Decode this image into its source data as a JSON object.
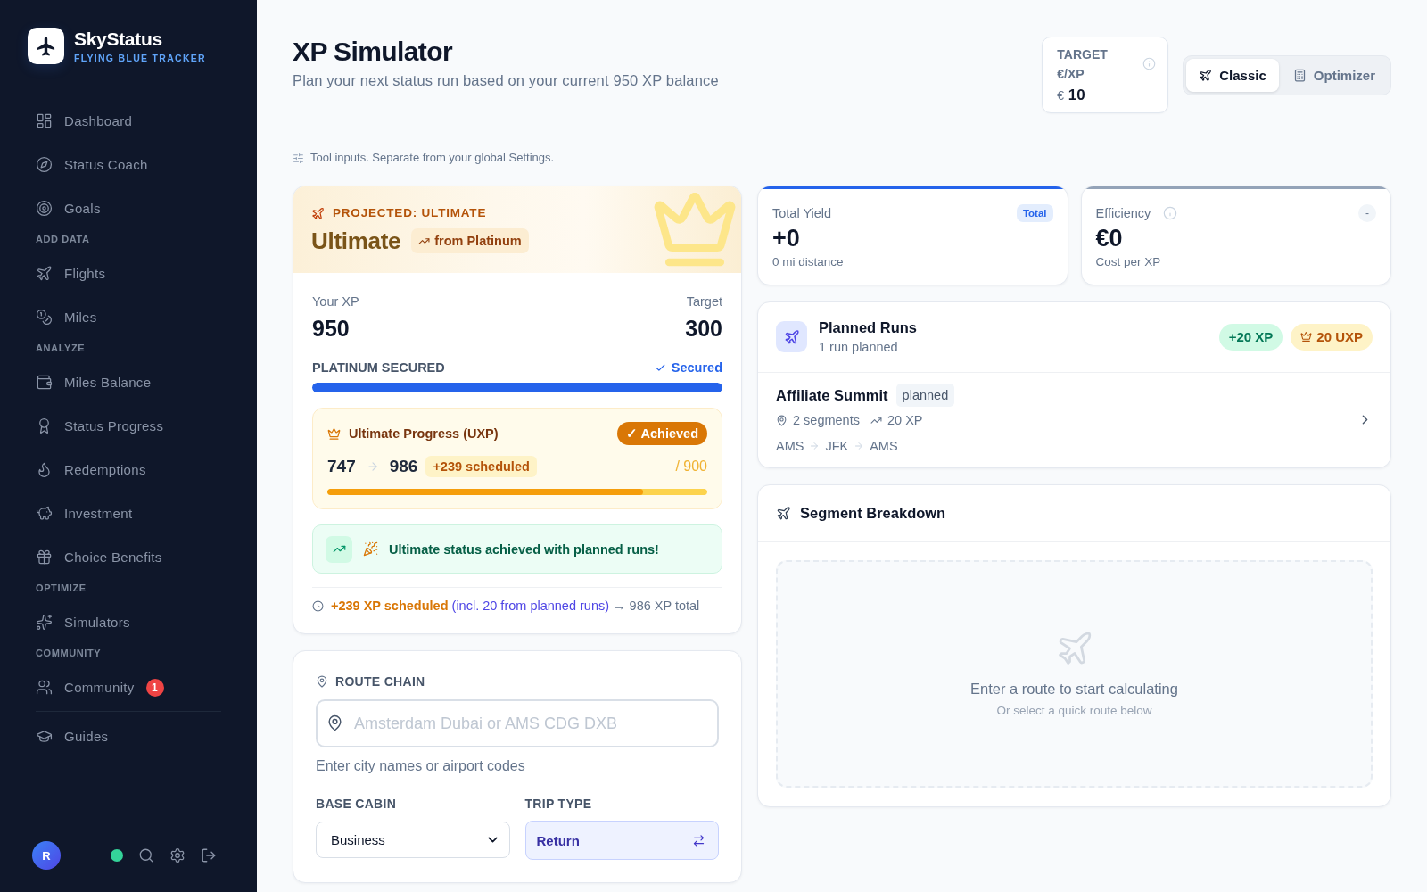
{
  "sidebar": {
    "brand": {
      "name": "SkyStatus",
      "tagline": "FLYING BLUE TRACKER"
    },
    "sections": [
      {
        "items": [
          {
            "label": "Dashboard",
            "selected": false
          },
          {
            "label": "Status Coach",
            "selected": false
          },
          {
            "label": "Goals",
            "selected": false
          }
        ]
      },
      {
        "heading": "ADD DATA",
        "items": [
          {
            "label": "Flights",
            "selected": false
          },
          {
            "label": "Miles",
            "selected": false
          }
        ]
      },
      {
        "heading": "ANALYZE",
        "items": [
          {
            "label": "Miles Balance",
            "selected": false
          },
          {
            "label": "Status Progress",
            "selected": false
          },
          {
            "label": "Redemptions",
            "selected": false
          },
          {
            "label": "Investment",
            "selected": false
          },
          {
            "label": "Choice Benefits",
            "selected": false
          }
        ]
      },
      {
        "heading": "OPTIMIZE",
        "items": [
          {
            "label": "Simulators",
            "selected": false
          }
        ]
      },
      {
        "heading": "COMMUNITY",
        "items": [
          {
            "label": "Community",
            "selected": false,
            "badge": "1"
          }
        ]
      }
    ],
    "extra_items": [
      {
        "label": "Guides",
        "selected": false
      }
    ],
    "user": {
      "initial": "R",
      "online": true
    }
  },
  "header": {
    "title": "XP Simulator",
    "subtitle": "Plan your next status run based on your current 950 XP balance"
  },
  "target": {
    "label": "TARGET €/XP",
    "currency": "€",
    "value": "10"
  },
  "mode_tabs": [
    {
      "label": "Classic",
      "selected": true
    },
    {
      "label": "Optimizer",
      "selected": false
    }
  ],
  "inputs_note": "Tool inputs. Separate from your global Settings.",
  "projection": {
    "eyebrow": "PROJECTED: ULTIMATE",
    "tier": "Ultimate",
    "from_badge": "from Platinum",
    "your_xp_label": "Your XP",
    "your_xp": "950",
    "target_label": "Target",
    "target": "300",
    "secured": {
      "label": "PLATINUM SECURED",
      "status": "Secured",
      "level": 1
    },
    "uxp": {
      "title": "Ultimate Progress (UXP)",
      "achieved": true,
      "achieved_label": "✓ Achieved",
      "current": "747",
      "projected": "986",
      "scheduled": "+239 scheduled",
      "goal": "/ 900",
      "level": 0.83,
      "scheduled_bar": {
        "level": 1
      }
    },
    "banner": "Ultimate status achieved with planned runs!",
    "summary": [
      {
        "kind": "scheduled",
        "text": "+239 XP scheduled"
      },
      {
        "kind": "planned",
        "text": "(incl. 20 from planned runs)"
      },
      {
        "kind": "total",
        "text": "→ 986 XP total"
      }
    ]
  },
  "route_form": {
    "heading": "ROUTE CHAIN",
    "route_field": {
      "placeholder": "Amsterdam Dubai or AMS CDG DXB"
    },
    "hint": "Enter city names or airport codes",
    "cabin": {
      "label": "BASE CABIN",
      "value": "Business"
    },
    "trip_type": {
      "label": "TRIP TYPE",
      "value": "Return"
    }
  },
  "stats": [
    {
      "kind": "yield",
      "label": "Total Yield",
      "badge": "Total",
      "value": "+0",
      "caption": "0 mi distance",
      "color": "#2563eb"
    },
    {
      "kind": "efficiency",
      "label": "Efficiency",
      "badge": "-",
      "value": "€0",
      "caption": "Cost per XP",
      "color": "#94a3b8"
    }
  ],
  "planned_runs": {
    "title": "Planned Runs",
    "subtitle": "1 run planned",
    "xp_badge": "+20 XP",
    "uxp_badge": "20 UXP",
    "runs": [
      {
        "name": "Affiliate Summit",
        "status": "planned",
        "segments": "2 segments",
        "xp": "20 XP",
        "route": [
          "AMS",
          "JFK",
          "AMS"
        ]
      }
    ]
  },
  "segment_breakdown": {
    "title": "Segment Breakdown",
    "empty_title": "Enter a route to start calculating",
    "empty_hint": "Or select a quick route below"
  }
}
